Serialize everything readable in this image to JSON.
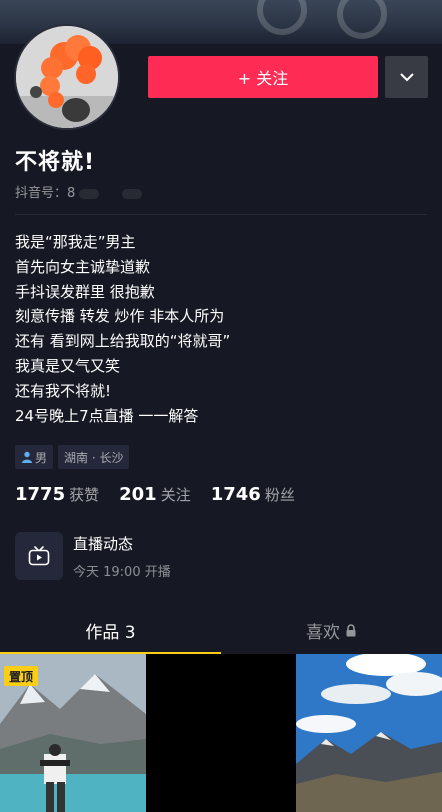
{
  "profile": {
    "follow_label": "+ 关注",
    "nickname": "不将就!",
    "douyin_id_prefix": "抖音号：8"
  },
  "bio": {
    "lines": [
      "我是“那我走”男主",
      "首先向女主诚挚道歉",
      "手抖误发群里 很抱歉",
      "刻意传播 转发 炒作 非本人所为",
      "还有 看到网上给我取的“将就哥”",
      "我真是又气又笑",
      "还有我不将就!",
      "24号晚上7点直播 一一解答"
    ]
  },
  "tags": {
    "gender": "男",
    "location": "湖南 · 长沙"
  },
  "stats": [
    {
      "num": "1775",
      "label": "获赞"
    },
    {
      "num": "201",
      "label": "关注"
    },
    {
      "num": "1746",
      "label": "粉丝"
    }
  ],
  "live": {
    "title": "直播动态",
    "time": "今天 19:00 开播"
  },
  "tabs": {
    "works": "作品 3",
    "likes": "喜欢"
  },
  "grid": {
    "pin_label": "置顶"
  },
  "colors": {
    "background": "#161823",
    "follow_red": "#fe2c55",
    "accent_yellow": "#face15"
  },
  "icons": {
    "more": "chevron-down-icon",
    "live": "tv-play-icon",
    "lock": "lock-icon",
    "gender": "person-icon"
  }
}
